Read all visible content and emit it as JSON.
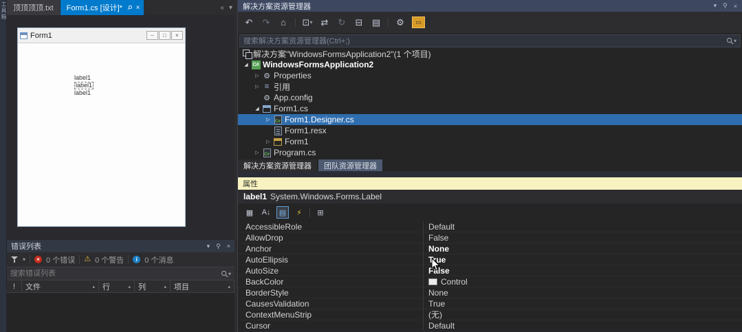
{
  "toolbox_strip": {
    "label": "工具箱"
  },
  "editor": {
    "tabs": [
      {
        "label": "顶顶顶顶.txt"
      },
      {
        "label": "Form1.cs [设计]*"
      }
    ],
    "tab_pin_icon": "⚲",
    "tab_close_icon": "×",
    "overflow": {
      "scroll": "«",
      "menu": "▾"
    },
    "form": {
      "title": "Form1",
      "buttons": {
        "minimize": "–",
        "maximize": "□",
        "close": "×"
      },
      "labels": [
        "label1",
        "label1",
        "label1"
      ]
    }
  },
  "error_list": {
    "title": "错误列表",
    "chrome": {
      "position": "▾",
      "pin": "⚲",
      "close": "×"
    },
    "error_glyph": "×",
    "warning_glyph": "⚠",
    "info_glyph": "i",
    "counts": {
      "errors": "0 个错误",
      "warnings": "0 个警告",
      "messages": "0 个消息"
    },
    "search_placeholder": "搜索错误列表",
    "columns": {
      "severity": "!",
      "file": "文件",
      "line": "行",
      "column": "列",
      "project": "项目"
    },
    "sort_glyph": "▴"
  },
  "solution_explorer": {
    "title": "解决方案资源管理器",
    "chrome": {
      "position": "▾",
      "pin": "⚲",
      "close": "×"
    },
    "toolbar": {
      "back": "↶",
      "forward": "↷",
      "home": "⌂",
      "switch_views": "⊡",
      "caret": "▾",
      "sync": "⇄",
      "refresh": "↻",
      "collapse_all": "⊟",
      "show_all_files": "▤",
      "properties": "⚙",
      "preview_selected": "▭"
    },
    "search_placeholder": "搜索解决方案资源管理器(Ctrl+;)",
    "expanders": {
      "expanded": "◢",
      "collapsed": "▷"
    },
    "csharp_badge": "C#",
    "gear_glyph": "⚙",
    "ref_glyph": "≡",
    "tree": [
      {
        "label": "解决方案\"WindowsFormsApplication2\"(1 个项目)"
      },
      {
        "label": "WindowsFormsApplication2"
      },
      {
        "label": "Properties"
      },
      {
        "label": "引用"
      },
      {
        "label": "App.config"
      },
      {
        "label": "Form1.cs"
      },
      {
        "label": "Form1.Designer.cs"
      },
      {
        "label": "Form1.resx"
      },
      {
        "label": "Form1"
      },
      {
        "label": "Program.cs"
      }
    ],
    "tabs": [
      {
        "label": "解决方案资源管理器"
      },
      {
        "label": "团队资源管理器"
      }
    ]
  },
  "properties_panel": {
    "title": "属性",
    "object_name": "label1",
    "object_type": "System.Windows.Forms.Label",
    "toolbar": {
      "categorized": "▦",
      "alphabetical": "A↓",
      "properties": "▤",
      "events": "⚡",
      "property_pages": "⊞"
    },
    "rows": [
      {
        "name": "AccessibleRole",
        "value": "Default"
      },
      {
        "name": "AllowDrop",
        "value": "False"
      },
      {
        "name": "Anchor",
        "value": "None"
      },
      {
        "name": "AutoEllipsis",
        "value": "True"
      },
      {
        "name": "AutoSize",
        "value": "False"
      },
      {
        "name": "BackColor",
        "value": "Control"
      },
      {
        "name": "BorderStyle",
        "value": "None"
      },
      {
        "name": "CausesValidation",
        "value": "True"
      },
      {
        "name": "ContextMenuStrip",
        "value": "(无)"
      },
      {
        "name": "Cursor",
        "value": "Default"
      }
    ]
  }
}
